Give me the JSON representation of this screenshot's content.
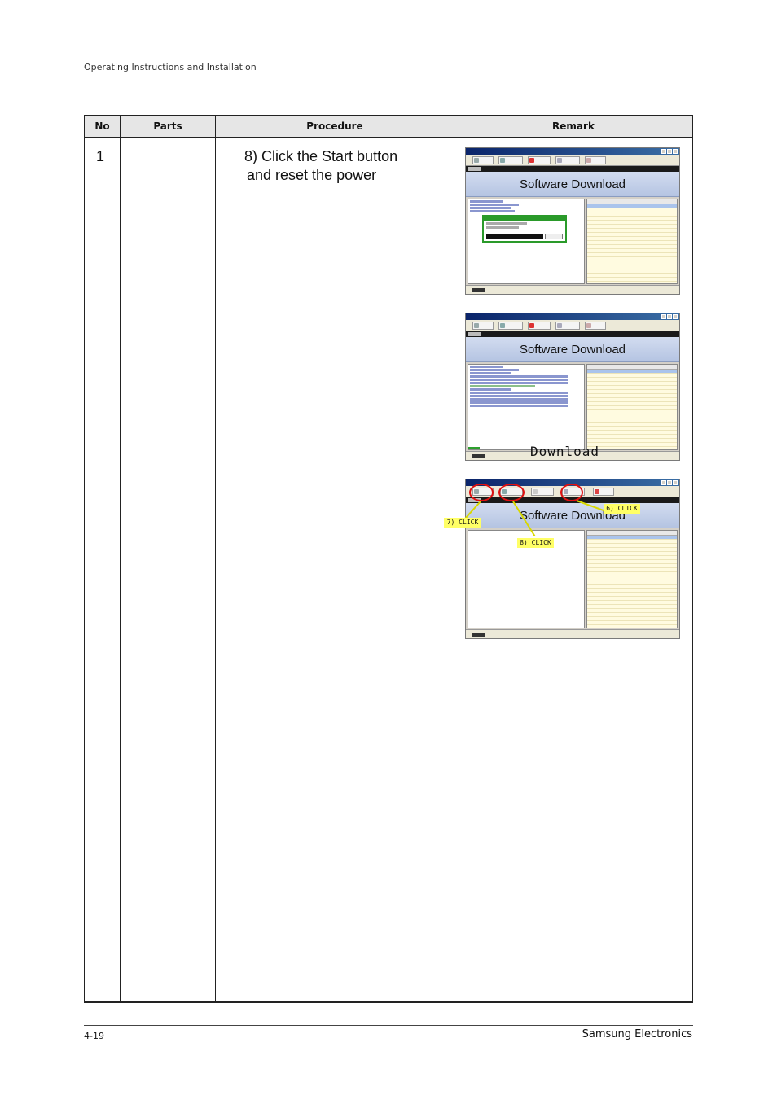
{
  "header": {
    "doc_title": "Operating Instructions and Installation"
  },
  "table": {
    "columns": [
      "No",
      "Parts",
      "Procedure",
      "Remark"
    ],
    "row": {
      "no": "1",
      "parts": "",
      "procedure_line1": "8) Click the Start button",
      "procedure_line2": "and reset the power"
    }
  },
  "screenshots": {
    "banner": "Software Download",
    "download_label": "Download",
    "callouts": {
      "c6": "6) CLICK",
      "c7": "7) CLICK",
      "c8": "8) CLICK"
    }
  },
  "footer": {
    "page_number": "4-19",
    "brand": "Samsung Electronics"
  },
  "colors": {
    "header_bg": "#e6e6e6",
    "callout_bg": "#ffff66",
    "ring": "#e01010"
  }
}
